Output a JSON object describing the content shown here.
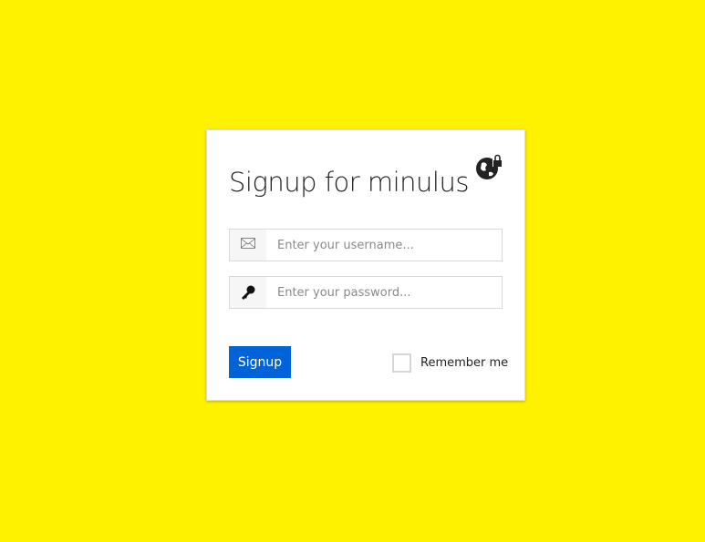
{
  "title": "Signup for minulus",
  "icons": {
    "brand": "globe-lock-icon",
    "username": "envelope-icon",
    "password": "key-icon"
  },
  "username": {
    "value": "",
    "placeholder": "Enter your username..."
  },
  "password": {
    "value": "",
    "placeholder": "Enter your password..."
  },
  "signup_label": "Signup",
  "remember": {
    "label": "Remember me",
    "checked": false
  },
  "colors": {
    "background": "#fff200",
    "accent": "#0064d8"
  }
}
